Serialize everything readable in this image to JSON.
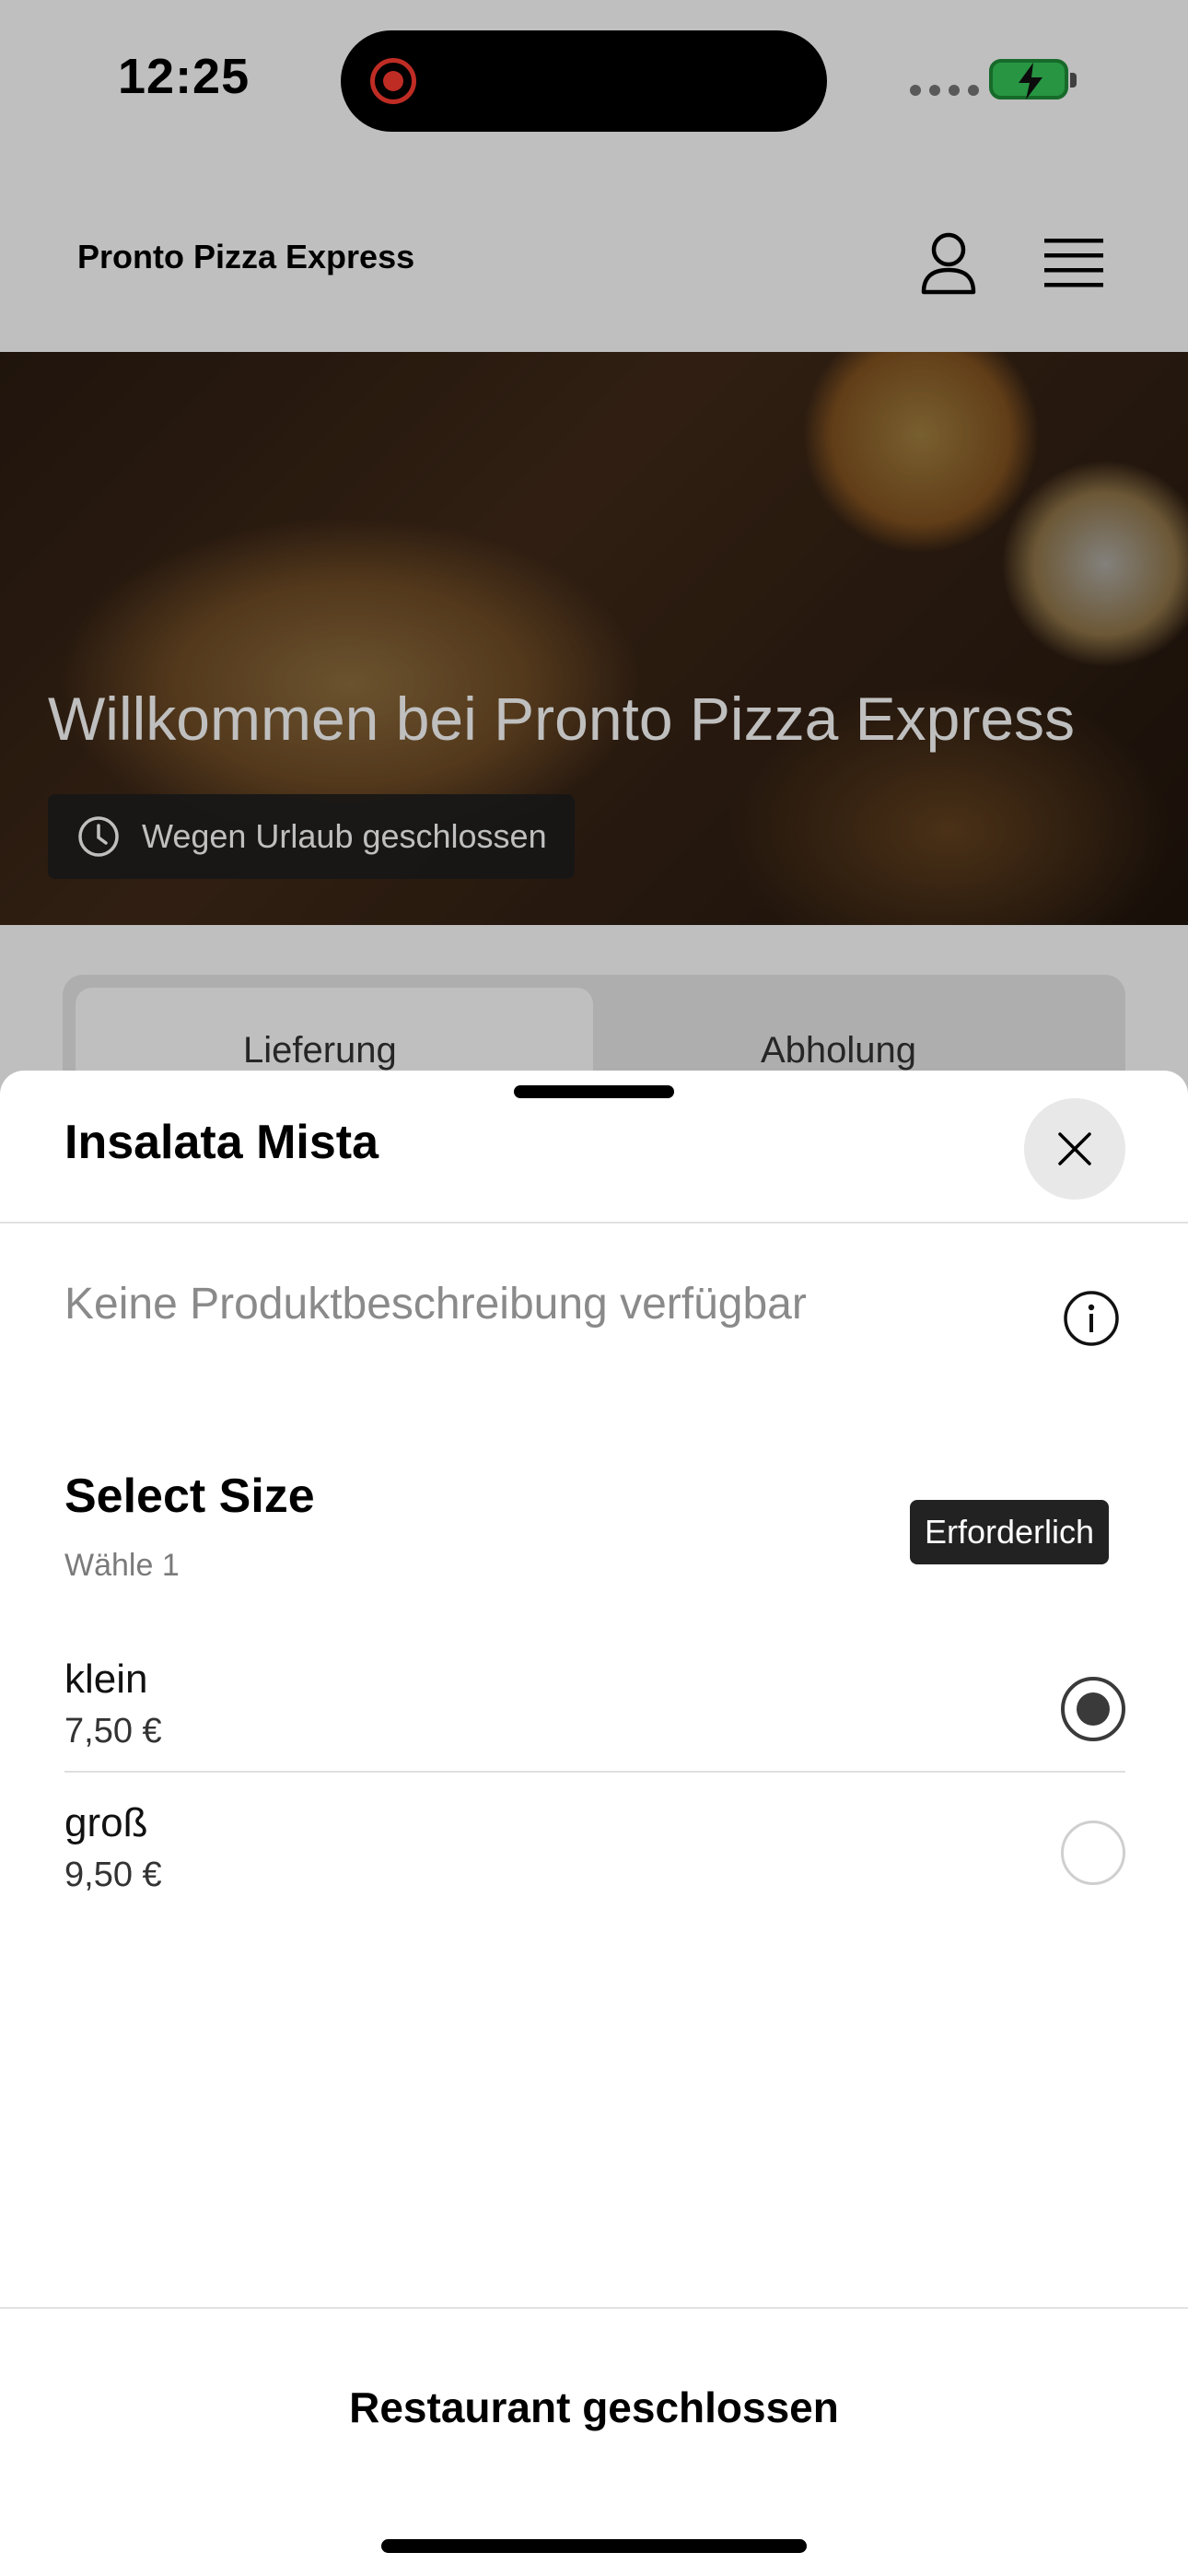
{
  "status_bar": {
    "time": "12:25"
  },
  "header": {
    "title": "Pronto Pizza Express",
    "account_icon": "person-icon",
    "menu_icon": "hamburger-icon"
  },
  "hero": {
    "title": "Willkommen bei Pronto Pizza Express",
    "status": "Wegen Urlaub geschlossen",
    "status_icon": "clock-icon"
  },
  "order_mode": {
    "tabs": [
      {
        "label": "Lieferung",
        "active": true
      },
      {
        "label": "Abholung",
        "active": false
      }
    ]
  },
  "sheet": {
    "title": "Insalata Mista",
    "description": "Keine Produktbeschreibung verfügbar",
    "option_group": {
      "title": "Select Size",
      "subtitle": "Wähle 1",
      "badge": "Erforderlich",
      "options": [
        {
          "name": "klein",
          "price": "7,50 €",
          "selected": true
        },
        {
          "name": "groß",
          "price": "9,50 €",
          "selected": false
        }
      ]
    },
    "footer_button": "Restaurant geschlossen"
  },
  "colors": {
    "accent": "#3a3a3a",
    "badge_bg": "#222222",
    "recording": "#ff3b30",
    "battery": "#34c759"
  }
}
